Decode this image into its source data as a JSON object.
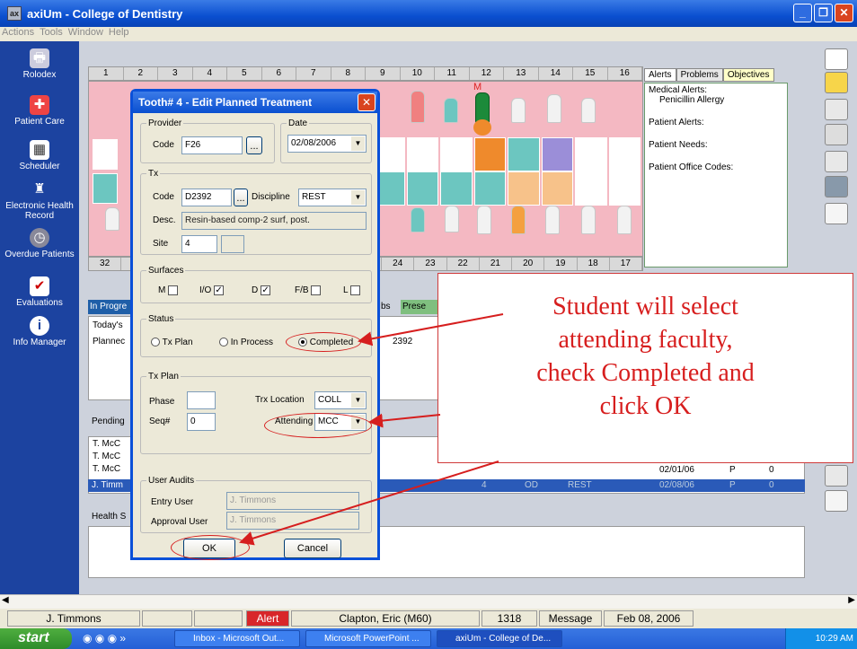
{
  "window": {
    "title": "axiUm - College of Dentistry"
  },
  "menu": [
    "Actions",
    "Tools",
    "Window",
    "Help"
  ],
  "nav": [
    {
      "label": "Rolodex",
      "icon": "printer-icon"
    },
    {
      "label": "Patient Care",
      "icon": "patient-care-icon"
    },
    {
      "label": "Scheduler",
      "icon": "calendar-icon"
    },
    {
      "label": "Electronic Health Record",
      "icon": "tooth-icon"
    },
    {
      "label": "Overdue Patients",
      "icon": "clock-icon"
    },
    {
      "label": "Evaluations",
      "icon": "checkmark-icon"
    },
    {
      "label": "Info Manager",
      "icon": "info-icon"
    }
  ],
  "chart": {
    "upper_numbers": [
      "1",
      "2",
      "3",
      "4",
      "5",
      "6",
      "7",
      "8",
      "9",
      "10",
      "11",
      "12",
      "13",
      "14",
      "15",
      "16"
    ],
    "lower_numbers": [
      "32",
      "",
      "",
      "",
      "",
      "",
      "",
      "",
      "",
      "24",
      "23",
      "22",
      "21",
      "20",
      "19",
      "18",
      "17"
    ],
    "marker": "M"
  },
  "right_tabs": [
    "Alerts",
    "Problems",
    "Objectives"
  ],
  "alerts": {
    "medical_label": "Medical Alerts:",
    "medical_value": "Penicillin Allergy",
    "patient_alerts": "Patient Alerts:",
    "patient_needs": "Patient Needs:",
    "office_codes": "Patient Office Codes:"
  },
  "lists": {
    "in_progress_tab": "In Progre",
    "bs_tab": "bs",
    "pres_tab": "Prese",
    "todays": "Today's",
    "planned": "Plannec",
    "code_fragment": "2392",
    "pending": "Pending",
    "rows": [
      "T. McC",
      "T. McC",
      "T. McC"
    ],
    "data_row": {
      "date": "02/01/06",
      "status": "P",
      "count": "0"
    },
    "selected_row": {
      "user": "J. Timm",
      "site": "4",
      "surf": "OD",
      "disc": "REST",
      "date": "02/08/06",
      "status": "P",
      "count": "0"
    },
    "health": "Health S"
  },
  "dialog": {
    "title": "Tooth# 4 - Edit Planned Treatment",
    "provider_legend": "Provider",
    "code_label": "Code",
    "provider_code": "F26",
    "date_legend": "Date",
    "date_value": "02/08/2006",
    "tx_legend": "Tx",
    "tx_code_label": "Code",
    "tx_code": "D2392",
    "discipline_label": "Discipline",
    "discipline": "REST",
    "desc_label": "Desc.",
    "desc": "Resin-based comp-2 surf, post.",
    "site_label": "Site",
    "site": "4",
    "surfaces_legend": "Surfaces",
    "surfaces": [
      {
        "label": "M",
        "checked": false
      },
      {
        "label": "I/O",
        "checked": true
      },
      {
        "label": "D",
        "checked": true
      },
      {
        "label": "F/B",
        "checked": false
      },
      {
        "label": "L",
        "checked": false
      }
    ],
    "status_legend": "Status",
    "status_options": [
      "Tx Plan",
      "In Process",
      "Completed"
    ],
    "status_selected": "Completed",
    "txplan_legend": "Tx Plan",
    "phase_label": "Phase",
    "phase": "",
    "seq_label": "Seq#",
    "seq": "0",
    "trx_location_label": "Trx Location",
    "trx_location": "COLL",
    "attending_label": "Attending",
    "attending": "MCC",
    "audits_legend": "User Audits",
    "entry_user_label": "Entry User",
    "entry_user": "J. Timmons",
    "approval_user_label": "Approval User",
    "approval_user": "J. Timmons",
    "ok": "OK",
    "cancel": "Cancel",
    "browse": "..."
  },
  "callout": {
    "lines": [
      "Student will select",
      "attending faculty,",
      "check Completed and",
      "click OK"
    ],
    "color": "#d71e1e"
  },
  "statusbar": {
    "user": "J. Timmons",
    "alert": "Alert",
    "patient": "Clapton, Eric (M60)",
    "chart_no": "1318",
    "message": "Message",
    "date": "Feb 08, 2006"
  },
  "taskbar": {
    "start": "start",
    "tasks": [
      "Inbox - Microsoft Out...",
      "Microsoft PowerPoint ...",
      "axiUm - College of De..."
    ],
    "clock": "10:29 AM"
  }
}
